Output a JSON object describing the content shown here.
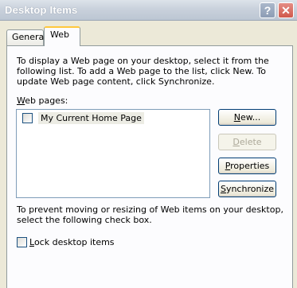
{
  "window": {
    "title": "Desktop Items",
    "help_symbol": "?",
    "close_symbol": "✕"
  },
  "tabs": [
    {
      "label": "General",
      "selected": false
    },
    {
      "label": "Web",
      "selected": true
    }
  ],
  "intro_text": "To display a Web page on your desktop, select it from the following list. To add a Web page to the list, click New.  To update Web page content, click Synchronize.",
  "web_pages": {
    "label_first": "W",
    "label_rest": "eb pages:",
    "items": [
      {
        "label": "My Current Home Page",
        "checked": false
      }
    ]
  },
  "buttons": {
    "new": {
      "mnemonic": "N",
      "rest": "ew..."
    },
    "delete": {
      "mnemonic": "D",
      "rest": "elete"
    },
    "properties": {
      "mnemonic": "P",
      "rest": "roperties"
    },
    "synchronize": {
      "mnemonic": "S",
      "rest": "ynchronize"
    }
  },
  "prevent_text": "To prevent moving or resizing of Web items on your desktop, select the following check box.",
  "lock": {
    "mnemonic": "L",
    "rest": "ock desktop items",
    "checked": false
  },
  "colors": {
    "titlebar": "#c9d1dc",
    "window_face": "#ece9d8",
    "tab_highlight": "#ffc83c",
    "close_button": "#d0594c"
  }
}
